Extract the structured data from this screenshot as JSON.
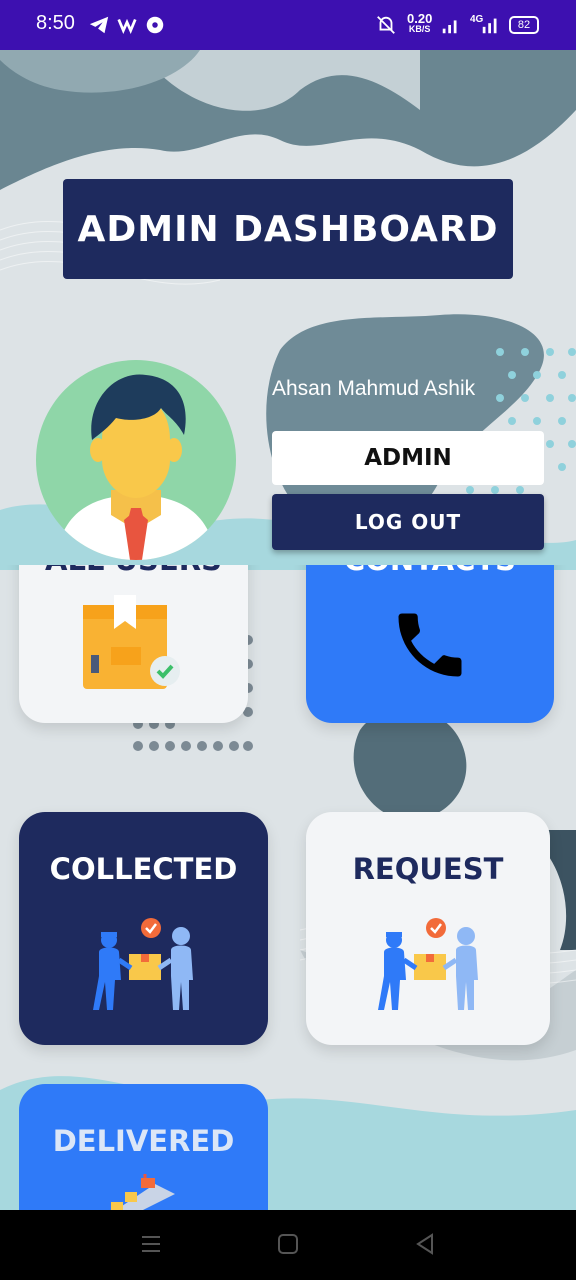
{
  "status_bar": {
    "time": "8:50",
    "speed": "0.20",
    "speed_unit": "KB/S",
    "network": "4G",
    "battery": "82"
  },
  "header": {
    "title": "ADMIN DASHBOARD"
  },
  "profile": {
    "name": "Ahsan Mahmud Ashik",
    "role": "ADMIN",
    "logout_label": "LOG OUT"
  },
  "cards": [
    {
      "label": "ALL USERS",
      "icon": "package-icon"
    },
    {
      "label": "CONTACTS",
      "icon": "phone-icon"
    },
    {
      "label": "COLLECTED",
      "icon": "handover-icon"
    },
    {
      "label": "REQUEST",
      "icon": "handover-icon"
    },
    {
      "label": "DELIVERED",
      "icon": "conveyor-icon"
    }
  ],
  "colors": {
    "status_bar": "#3d10b0",
    "navy": "#1e2a5e",
    "blue": "#2f7af8",
    "light_card": "#f3f5f7",
    "avatar_bg": "#8fd6a8"
  }
}
